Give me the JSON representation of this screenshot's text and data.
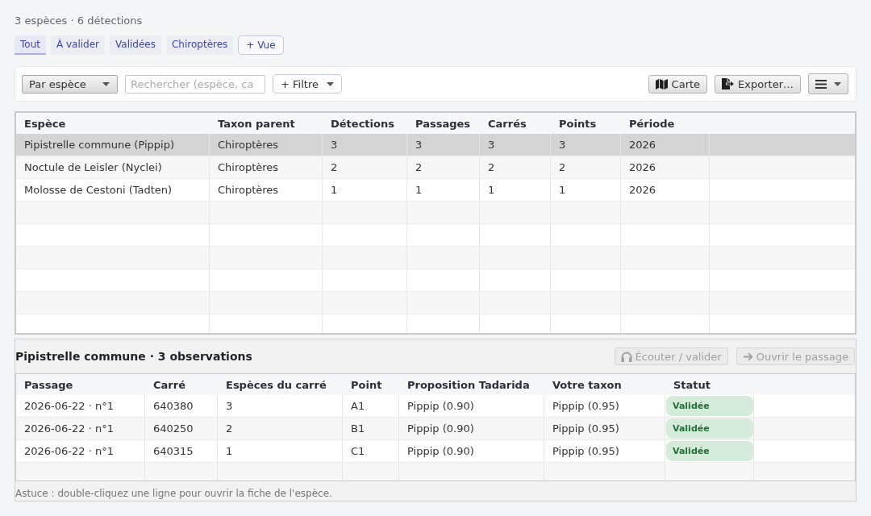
{
  "summary": "3 espèces · 6 détections",
  "tabs": [
    {
      "label": "Tout",
      "selected": true
    },
    {
      "label": "À valider",
      "selected": false
    },
    {
      "label": "Validées",
      "selected": false
    },
    {
      "label": "Chiroptères",
      "selected": false
    }
  ],
  "add_view_button": "+ Vue",
  "toolbar": {
    "group_by": {
      "value": "Par espèce"
    },
    "search": {
      "placeholder": "Rechercher (espèce, ca"
    },
    "filter_button": {
      "label": "+ Filtre"
    },
    "tool_buttons": [
      {
        "kind": "map",
        "label": "Carte"
      },
      {
        "kind": "export",
        "label": "Exporter…"
      },
      {
        "kind": "menu"
      }
    ]
  },
  "species_table": {
    "columns": [
      "Espèce",
      "Taxon parent",
      "Détections",
      "Passages",
      "Carrés",
      "Points",
      "Période"
    ],
    "rows": [
      {
        "cells": [
          "Pipistrelle commune (Pippip)",
          "Chiroptères",
          "3",
          "3",
          "3",
          "3",
          "2026"
        ],
        "selected": true
      },
      {
        "cells": [
          "Noctule de Leisler (Nyclei)",
          "Chiroptères",
          "2",
          "2",
          "2",
          "2",
          "2026"
        ],
        "selected": false
      },
      {
        "cells": [
          "Molosse de Cestoni (Tadten)",
          "Chiroptères",
          "1",
          "1",
          "1",
          "1",
          "2026"
        ],
        "selected": false
      }
    ]
  },
  "detail": {
    "title": "Pipistrelle commune · 3 observations",
    "actions": [
      {
        "kind": "listen",
        "label": "Écouter / valider",
        "disabled": true
      },
      {
        "kind": "open",
        "label": "Ouvrir le passage",
        "disabled": true
      }
    ],
    "table": {
      "columns": [
        "Passage",
        "Carré",
        "Espèces du carré",
        "Point",
        "Proposition Tadarida",
        "Votre taxon",
        "Statut"
      ],
      "rows": [
        {
          "cells": [
            "2026-06-22 · n°1",
            "640380",
            "3",
            "A1",
            "Pippip (0.90)",
            "Pippip (0.95)"
          ],
          "status": "Validée"
        },
        {
          "cells": [
            "2026-06-22 · n°1",
            "640250",
            "2",
            "B1",
            "Pippip (0.90)",
            "Pippip (0.95)"
          ],
          "status": "Validée"
        },
        {
          "cells": [
            "2026-06-22 · n°1",
            "640315",
            "1",
            "C1",
            "Pippip (0.90)",
            "Pippip (0.95)"
          ],
          "status": "Validée"
        }
      ]
    },
    "hint": "Astuce : double-cliquez une ligne pour ouvrir la fiche de l'espèce."
  }
}
